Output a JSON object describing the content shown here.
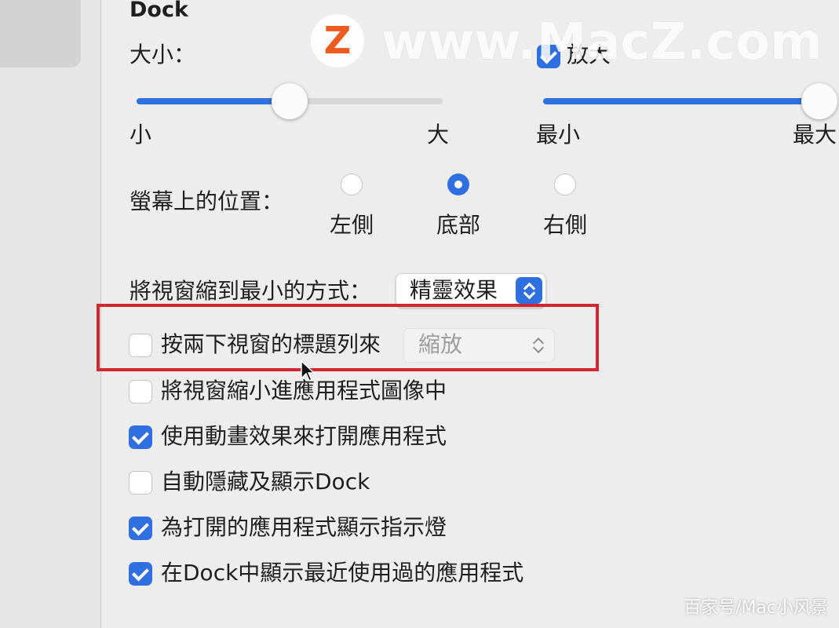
{
  "section_title": "Dock",
  "size": {
    "label": "大小：",
    "min_label": "小",
    "max_label": "大",
    "value": 0.5
  },
  "magnification": {
    "label": "放大",
    "checked": true,
    "min_label": "最小",
    "max_label": "最大",
    "value": 1.0
  },
  "position": {
    "label": "螢幕上的位置：",
    "options": [
      {
        "label": "左側",
        "selected": false
      },
      {
        "label": "底部",
        "selected": true
      },
      {
        "label": "右側",
        "selected": false
      }
    ]
  },
  "minimize_effect": {
    "label": "將視窗縮到最小的方式：",
    "value": "精靈效果"
  },
  "double_click": {
    "label": "按兩下視窗的標題列來",
    "checked": false,
    "value": "縮放"
  },
  "checkboxes": [
    {
      "label": "將視窗縮小進應用程式圖像中",
      "checked": false
    },
    {
      "label": "使用動畫效果來打開應用程式",
      "checked": true
    },
    {
      "label": "自動隱藏及顯示Dock",
      "checked": false
    },
    {
      "label": "為打開的應用程式顯示指示燈",
      "checked": true
    },
    {
      "label": "在Dock中顯示最近使用過的應用程式",
      "checked": true
    }
  ],
  "watermark": {
    "logo_letter": "Z",
    "text": "www.MacZ.com"
  },
  "credit": "百家号/Mac小风景",
  "colors": {
    "accent": "#2f6fe0",
    "highlight_box": "#d1272e"
  }
}
